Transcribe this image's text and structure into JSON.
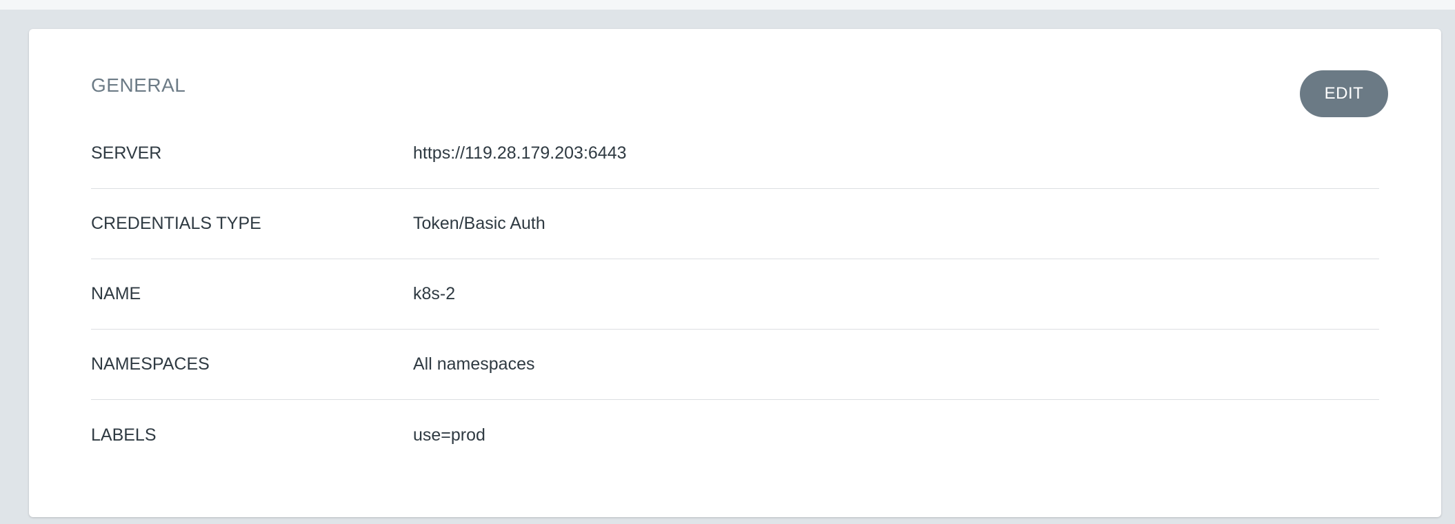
{
  "section": {
    "title": "GENERAL",
    "edit_label": "EDIT"
  },
  "rows": [
    {
      "label": "SERVER",
      "value": "https://119.28.179.203:6443"
    },
    {
      "label": "CREDENTIALS TYPE",
      "value": "Token/Basic Auth"
    },
    {
      "label": "NAME",
      "value": "k8s-2"
    },
    {
      "label": "NAMESPACES",
      "value": "All namespaces"
    },
    {
      "label": "LABELS",
      "value": "use=prod"
    }
  ],
  "colors": {
    "background": "#dfe4e8",
    "card": "#ffffff",
    "button": "#6b7a85",
    "title": "#6c7b86",
    "text": "#2f3a42",
    "divider": "#dcdfe2"
  }
}
